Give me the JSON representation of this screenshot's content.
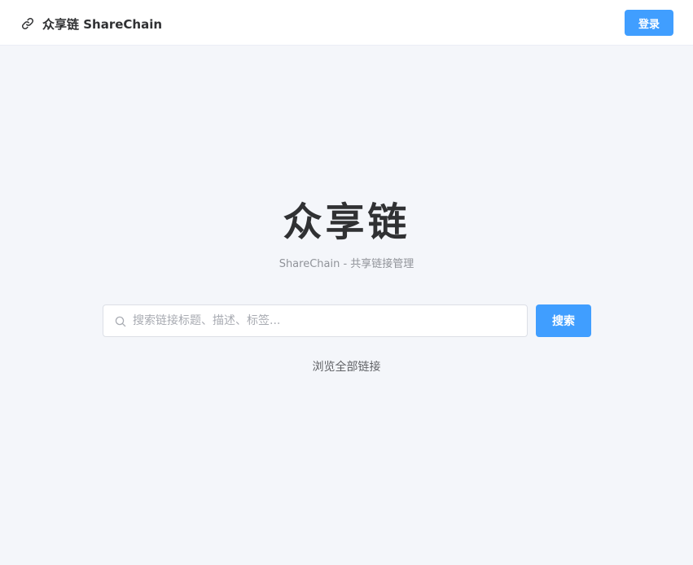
{
  "header": {
    "brand_icon": "link-icon",
    "brand_text": "众享链 ShareChain",
    "login_label": "登录"
  },
  "hero": {
    "title": "众享链",
    "subtitle": "ShareChain - 共享链接管理"
  },
  "search": {
    "icon": "search-icon",
    "placeholder": "搜索链接标题、描述、标签...",
    "value": "",
    "button_label": "搜索"
  },
  "browse": {
    "label": "浏览全部链接"
  },
  "colors": {
    "primary": "#409eff",
    "background": "#f4f6fa",
    "header_bg": "#ffffff"
  }
}
